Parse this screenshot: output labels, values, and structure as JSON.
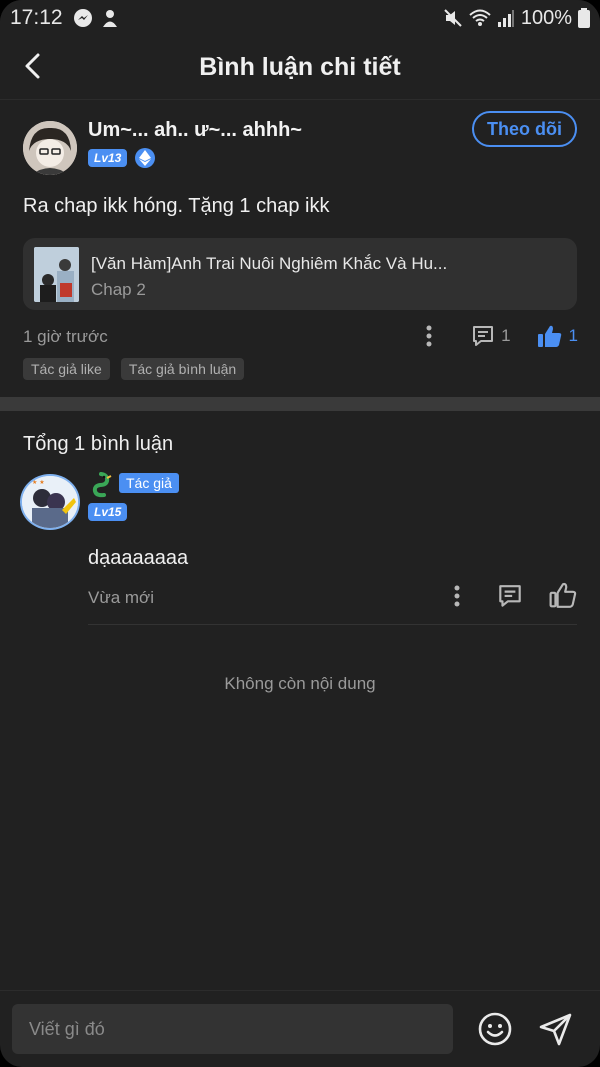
{
  "status_bar": {
    "time": "17:12",
    "battery": "100%"
  },
  "header": {
    "title": "Bình luận chi tiết",
    "back_icon": "chevron-left-icon"
  },
  "post": {
    "username": "Um~... ah.. ư~... ahhh~",
    "level": "Lv13",
    "follow_label": "Theo dõi",
    "content": "Ra chap ikk hóng. Tặng 1 chap ikk",
    "card": {
      "title": "[Văn Hàm]Anh Trai Nuôi Nghiêm Khắc Và Hu...",
      "subtitle": "Chap 2"
    },
    "time": "1 giờ trước",
    "reply_count": "1",
    "like_count": "1",
    "tags": [
      "Tác giả like",
      "Tác giả bình luận"
    ]
  },
  "comments": {
    "total": "Tổng 1 bình luận",
    "items": [
      {
        "author_tag": "Tác giả",
        "level": "Lv15",
        "text": "dạaaaaaaa",
        "time": "Vừa mới"
      }
    ],
    "end_text": "Không còn nội dung"
  },
  "composer": {
    "placeholder": "Viết gì đó"
  },
  "colors": {
    "accent": "#4b8ff2",
    "background": "#212121",
    "card": "#303030"
  }
}
